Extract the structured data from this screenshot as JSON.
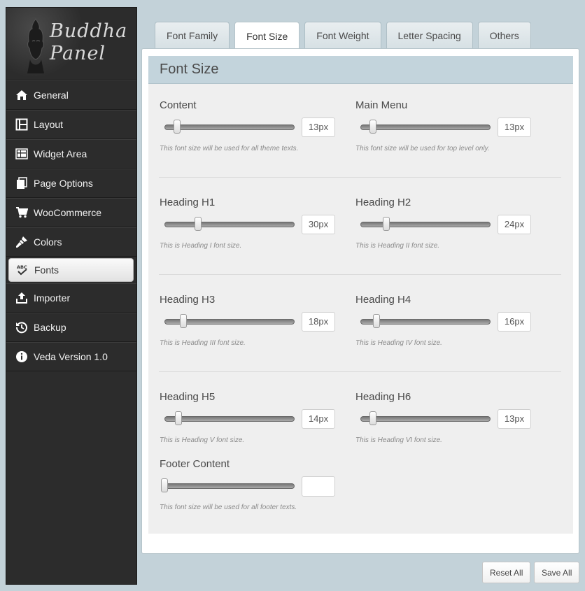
{
  "logo": {
    "line1": "Buddha",
    "line2": "Panel"
  },
  "sidebar": {
    "items": [
      {
        "label": "General",
        "icon": "home-icon"
      },
      {
        "label": "Layout",
        "icon": "layout-icon"
      },
      {
        "label": "Widget Area",
        "icon": "widget-icon"
      },
      {
        "label": "Page Options",
        "icon": "pages-icon"
      },
      {
        "label": "WooCommerce",
        "icon": "cart-icon"
      },
      {
        "label": "Colors",
        "icon": "brush-icon"
      },
      {
        "label": "Fonts",
        "icon": "fonts-icon",
        "active": true
      },
      {
        "label": "Importer",
        "icon": "upload-icon"
      },
      {
        "label": "Backup",
        "icon": "history-icon"
      },
      {
        "label": "Veda Version 1.0",
        "icon": "info-icon"
      }
    ]
  },
  "tabs": [
    {
      "label": "Font Family"
    },
    {
      "label": "Font Size",
      "active": true
    },
    {
      "label": "Font Weight"
    },
    {
      "label": "Letter Spacing"
    },
    {
      "label": "Others"
    }
  ],
  "section": {
    "title": "Font Size"
  },
  "fields": {
    "content": {
      "label": "Content",
      "value": "13px",
      "help": "This font size will be used for all theme texts.",
      "level": 0.1
    },
    "main_menu": {
      "label": "Main Menu",
      "value": "13px",
      "help": "This font size will be used for top level only.",
      "level": 0.1
    },
    "h1": {
      "label": "Heading H1",
      "value": "30px",
      "help": "This is Heading I font size.",
      "level": 0.27
    },
    "h2": {
      "label": "Heading H2",
      "value": "24px",
      "help": "This is Heading II font size.",
      "level": 0.21
    },
    "h3": {
      "label": "Heading H3",
      "value": "18px",
      "help": "This is Heading III font size.",
      "level": 0.15
    },
    "h4": {
      "label": "Heading H4",
      "value": "16px",
      "help": "This is Heading IV font size.",
      "level": 0.13
    },
    "h5": {
      "label": "Heading H5",
      "value": "14px",
      "help": "This is Heading V font size.",
      "level": 0.11
    },
    "h6": {
      "label": "Heading H6",
      "value": "13px",
      "help": "This is Heading VI font size.",
      "level": 0.1
    },
    "footer": {
      "label": "Footer Content",
      "value": "",
      "help": "This font size will be used for all footer texts.",
      "level": 0
    }
  },
  "footer_buttons": {
    "reset": "Reset All",
    "save": "Save All"
  }
}
